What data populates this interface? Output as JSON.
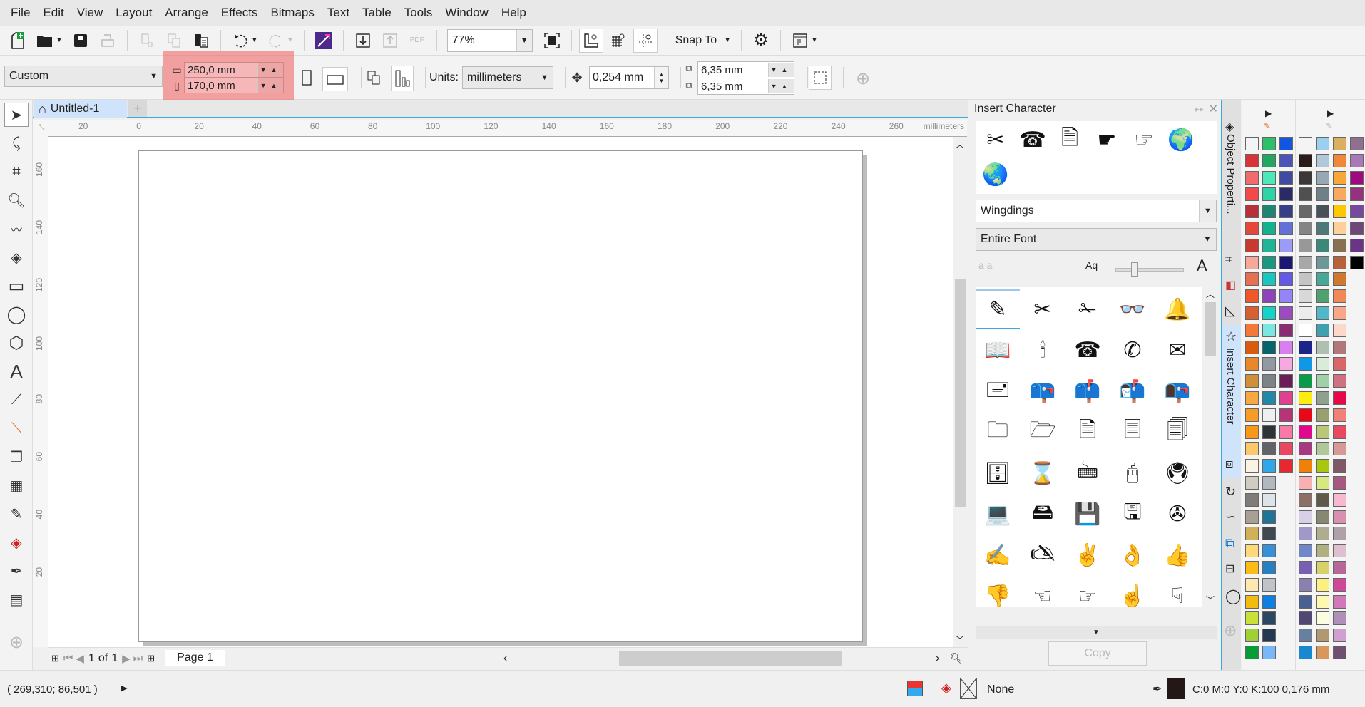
{
  "menu": [
    "File",
    "Edit",
    "View",
    "Layout",
    "Arrange",
    "Effects",
    "Bitmaps",
    "Text",
    "Table",
    "Tools",
    "Window",
    "Help"
  ],
  "toolbar": {
    "zoom_value": "77%",
    "snap_to_label": "Snap To",
    "icons": [
      "new-document",
      "open",
      "save",
      "print",
      "cut",
      "copy",
      "paste",
      "undo",
      "redo",
      "corel-connect",
      "import",
      "export",
      "publish-pdf",
      "full-screen-preview",
      "show-rulers",
      "show-grid",
      "show-guidelines",
      "options",
      "application-launcher"
    ]
  },
  "property_bar": {
    "page_preset": "Custom",
    "width": "250,0 mm",
    "height": "170,0 mm",
    "units_label": "Units:",
    "units_value": "millimeters",
    "nudge_value": "0,254 mm",
    "duplicate_x": "6,35 mm",
    "duplicate_y": "6,35 mm"
  },
  "document": {
    "tab_title": "Untitled-1",
    "ruler_unit": "millimeters",
    "h_ruler_ticks": [
      "20",
      "0",
      "20",
      "40",
      "60",
      "80",
      "100",
      "120",
      "140",
      "160",
      "180",
      "200",
      "220",
      "240",
      "260"
    ],
    "v_ruler_ticks": [
      "160",
      "140",
      "120",
      "100",
      "80",
      "60",
      "40",
      "20"
    ]
  },
  "page_nav": {
    "current": "1",
    "of_label": "of",
    "total": "1",
    "page_tab": "Page 1"
  },
  "status": {
    "coordinates": "( 269,310; 86,501 )",
    "fill_label": "None",
    "outline_info": "C:0 M:0 Y:0 K:100  0,176 mm"
  },
  "insert_character": {
    "title": "Insert Character",
    "font": "Wingdings",
    "subset": "Entire Font",
    "recent": [
      "✂",
      "☎",
      "🗎",
      "☛",
      "☞",
      "🌍",
      "🌏"
    ],
    "glyphs": [
      "✎",
      "✂",
      "✁",
      "👓",
      "🔔",
      "📖",
      "🕯",
      "☎",
      "✆",
      "✉",
      "🖃",
      "📪",
      "📫",
      "📬",
      "📭",
      "🗀",
      "🗁",
      "🗎",
      "🗏",
      "🗐",
      "🗄",
      "⌛",
      "🖮",
      "🖰",
      "🖲",
      "💻",
      "🖴",
      "💾",
      "🖫",
      "✇",
      "✍",
      "🖎",
      "✌",
      "👌",
      "👍",
      "👎",
      "☜",
      "☞",
      "☝",
      "☟"
    ],
    "copy_label": "Copy"
  },
  "side_tabs": {
    "object_properties": "Object Properti...",
    "insert_character": "Insert Character"
  },
  "palette1": [
    [
      "none",
      "#2fbf6a",
      "#1256e0"
    ],
    [
      "#d9333a",
      "#23a660",
      "#4c54b8"
    ],
    [
      "#f26b6b",
      "#4de8b8",
      "#3f4aa0"
    ],
    [
      "#f24a4a",
      "#2ed4a6",
      "#2a2b66"
    ],
    [
      "#b8303a",
      "#1e8670",
      "#363f86"
    ],
    [
      "#e5473a",
      "#12b28e",
      "#6470d8"
    ],
    [
      "#c73a30",
      "#20b596",
      "#9c9cf8"
    ],
    [
      "#f8a898",
      "#1a9880",
      "#1a1870"
    ],
    [
      "#e8704e",
      "#18c8c0",
      "#6658e6"
    ],
    [
      "#f0582a",
      "#8e44b8",
      "#9484f8"
    ],
    [
      "#d86030",
      "#14d4c8",
      "#9a4cc0"
    ],
    [
      "#f47838",
      "#78e8e0",
      "#8a2c72"
    ],
    [
      "#d85c10",
      "#086468",
      "#d880f0"
    ],
    [
      "#e8882a",
      "#909aa0",
      "#f8a8e0"
    ],
    [
      "#d09038",
      "#7c8488",
      "#6e1c58"
    ],
    [
      "#f8a840",
      "#2088a8",
      "#e04090"
    ],
    [
      "#f89c28",
      "#eef0f0",
      "#b83478"
    ],
    [
      "#f89818",
      "#2c3438",
      "#f878a8"
    ],
    [
      "#fcc86c",
      "#606468",
      "#e84860"
    ],
    [
      "#faf2e2",
      "#30a8e8",
      "#e82830"
    ],
    [
      "#d0ccc0",
      "#b0b8c0",
      null
    ],
    [
      "#807c78",
      "#dde4e8",
      null
    ],
    [
      "#a8a094",
      "#207498",
      null
    ],
    [
      "#d0b058",
      "#404850",
      null
    ],
    [
      "#ffd878",
      "#3890d8",
      null
    ],
    [
      "#fcbc18",
      "#2880c0",
      null
    ],
    [
      "#ffe8b0",
      "#c0c4c8",
      null
    ],
    [
      "#f0bc10",
      "#1080e0",
      null
    ],
    [
      "#c8e038",
      "#2c4860",
      null
    ],
    [
      "#a0d038",
      "#243850",
      null
    ],
    [
      "#089c38",
      "#78b8f8",
      null
    ]
  ],
  "palette2": [
    [
      "none",
      "#9cd0f0",
      "#d8b060",
      "#907090"
    ],
    [
      "#2a1c18",
      "#b0c8d8",
      "#f08838",
      "#a878b8"
    ],
    [
      "#3c3838",
      "#98a8b4",
      "#f8a838",
      "#a00880"
    ],
    [
      "#505050",
      "#708088",
      "#f8a860",
      "#983080"
    ],
    [
      "#686868",
      "#485058",
      "#fcc800",
      "#7848a0"
    ],
    [
      "#848484",
      "#4c7878",
      "#fcd098",
      "#704878"
    ],
    [
      "#989898",
      "#3c8878",
      "#887050",
      "#6c3488"
    ],
    [
      "#a8a8a8",
      "#6c9898",
      "#b86038",
      "#000000"
    ],
    [
      "#c4c4c4",
      "#48a898",
      "#d0782c",
      null
    ],
    [
      "#d8d8d8",
      "#50a070",
      "#f08858",
      null
    ],
    [
      "#ececec",
      "#50b8c8",
      "#f8a888",
      null
    ],
    [
      "#ffffff",
      "#40a0b0",
      "#fcd8c8",
      null
    ],
    [
      "#1c2488",
      "#b0c0b0",
      "#b07878",
      null
    ],
    [
      "#1098e8",
      "#d8ecd8",
      "#d86868",
      null
    ],
    [
      "#089c48",
      "#a0d0a8",
      "#d07080",
      null
    ],
    [
      "#fcec10",
      "#90a090",
      "#e80848",
      null
    ],
    [
      "#e80818",
      "#98a070",
      "#f08078",
      null
    ],
    [
      "#e0088c",
      "#b8c878",
      "#e84860",
      null
    ],
    [
      "#a83880",
      "#b0c898",
      "#d89898",
      null
    ],
    [
      "#f08008",
      "#a8c810",
      "#805868",
      null
    ],
    [
      "#f8b0b0",
      "#d8e880",
      "#a85880",
      null
    ],
    [
      "#8c7068",
      "#605848",
      "#f8b8d0",
      null
    ],
    [
      "#d8d0e8",
      "#888870",
      "#d890b0",
      null
    ],
    [
      "#a098c8",
      "#b0ac90",
      "#b0a0a8",
      null
    ],
    [
      "#7088c8",
      "#b0b080",
      "#e0c0d0",
      null
    ],
    [
      "#7860b0",
      "#d8d068",
      "#b86898",
      null
    ],
    [
      "#8c80b0",
      "#fcf080",
      "#d04898",
      null
    ],
    [
      "#4a6090",
      "#fcf8b0",
      "#d078b8",
      null
    ],
    [
      "#504870",
      "#fcfce0",
      "#b090b8",
      null
    ],
    [
      "#6880a0",
      "#b09870",
      "#d0a0d0",
      null
    ],
    [
      "#1888d0",
      "#d8985c",
      "#705070",
      null
    ]
  ]
}
